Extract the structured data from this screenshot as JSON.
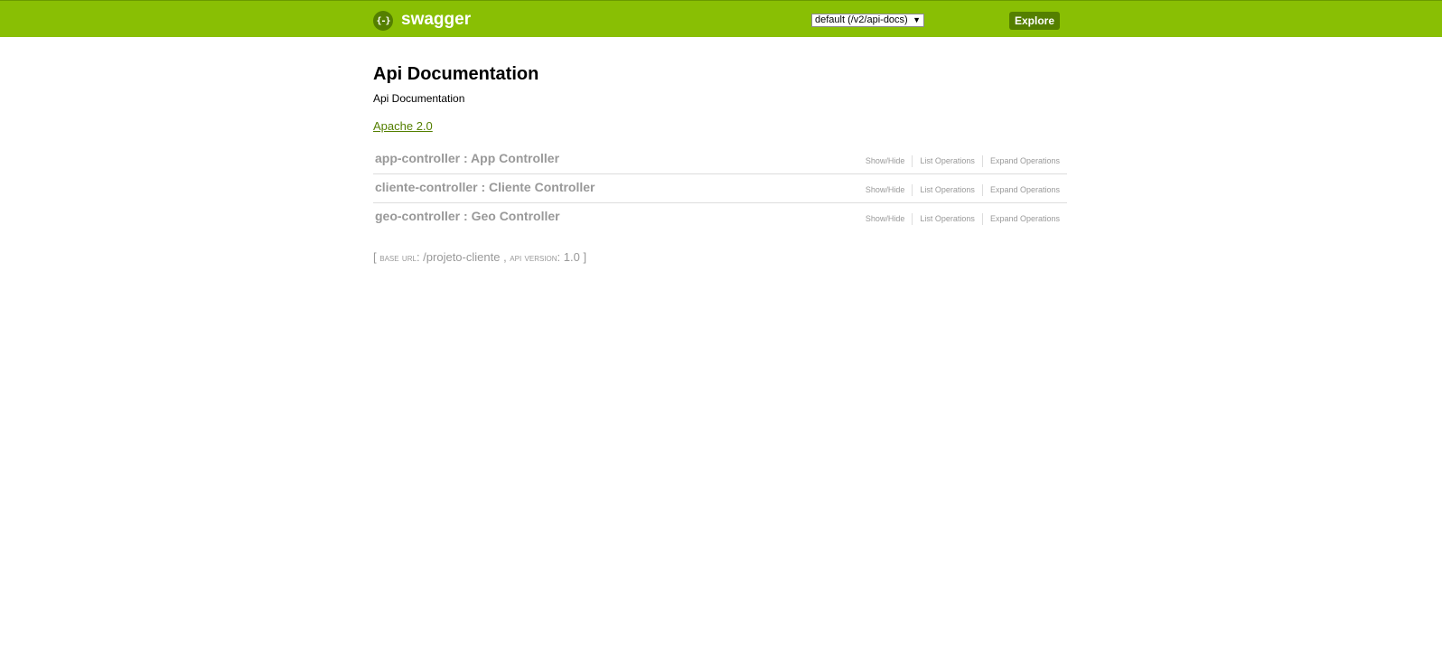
{
  "header": {
    "logo_icon": "{-}",
    "logo_text": "swagger",
    "api_selector_value": "default (/v2/api-docs)",
    "explore_label": "Explore",
    "colors": {
      "bar": "#89bf04",
      "dark_green": "#547f00"
    }
  },
  "info": {
    "title": "Api Documentation",
    "description": "Api Documentation",
    "license_label": "Apache 2.0"
  },
  "resources": [
    {
      "name": "app-controller",
      "separator": " : ",
      "description": "App Controller",
      "actions": [
        "Show/Hide",
        "List Operations",
        "Expand Operations"
      ]
    },
    {
      "name": "cliente-controller",
      "separator": " : ",
      "description": "Cliente Controller",
      "actions": [
        "Show/Hide",
        "List Operations",
        "Expand Operations"
      ]
    },
    {
      "name": "geo-controller",
      "separator": " : ",
      "description": "Geo Controller",
      "actions": [
        "Show/Hide",
        "List Operations",
        "Expand Operations"
      ]
    }
  ],
  "footer": {
    "open_bracket": "[",
    "base_url_label": "base url",
    "base_url_value": "/projeto-cliente",
    "api_version_label": "api version",
    "api_version_value": "1.0",
    "close_bracket": "]"
  }
}
